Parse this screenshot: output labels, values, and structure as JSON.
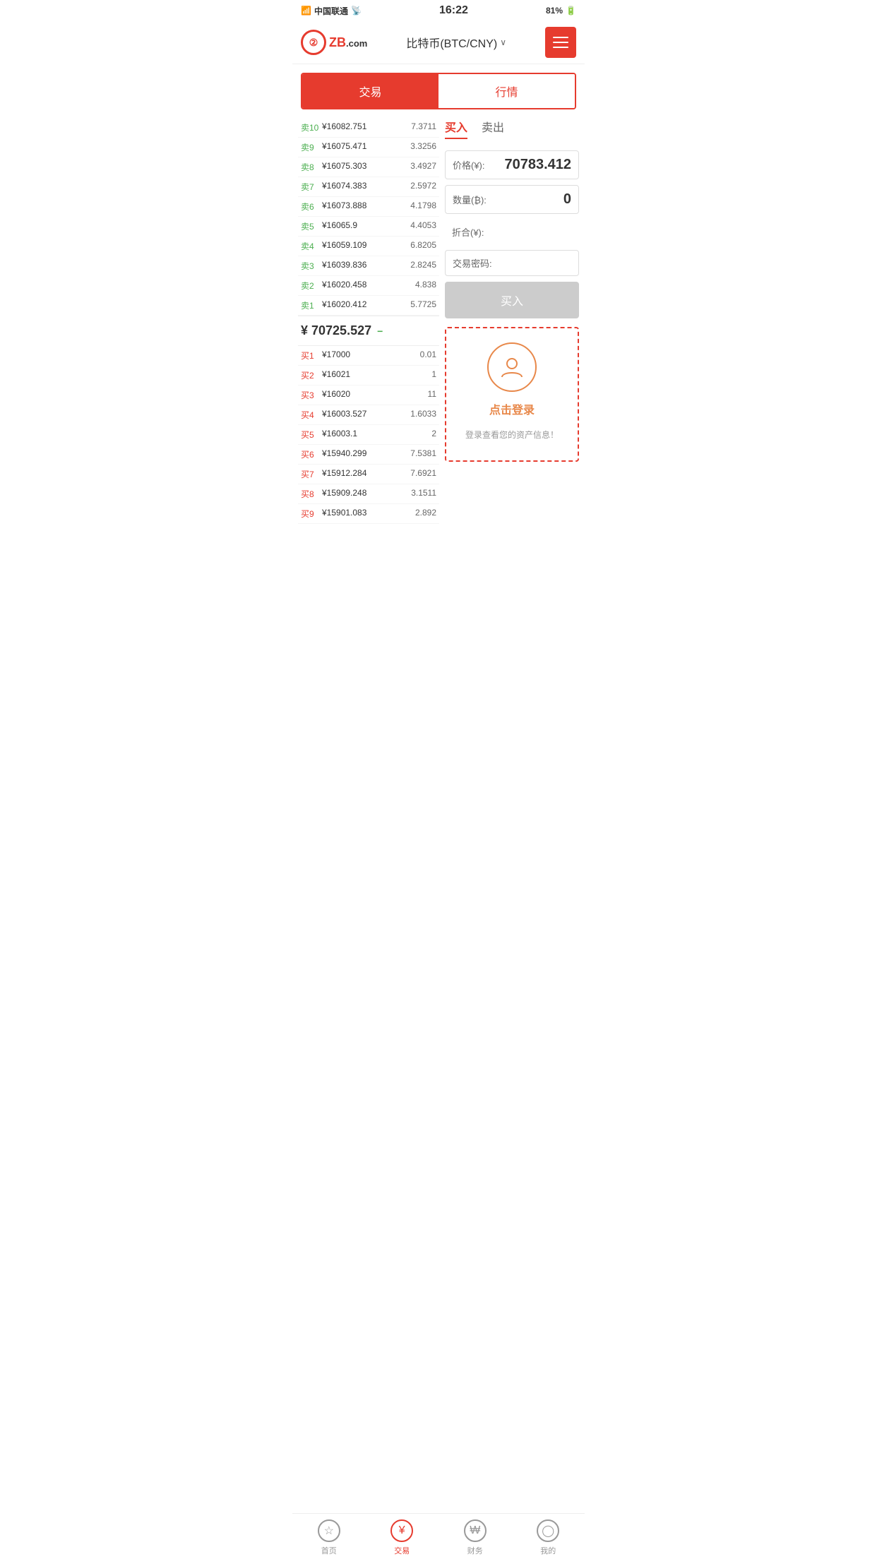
{
  "statusBar": {
    "carrier": "中国联通",
    "time": "16:22",
    "battery": "81%"
  },
  "header": {
    "logoText": "ZB",
    "logoDomain": ".com",
    "title": "比特币(BTC/CNY)",
    "menuIcon": "menu-icon"
  },
  "mainTabs": [
    {
      "id": "trade",
      "label": "交易",
      "active": true
    },
    {
      "id": "market",
      "label": "行情",
      "active": false
    }
  ],
  "orderBook": {
    "sellOrders": [
      {
        "label": "卖10",
        "price": "¥16082.751",
        "amount": "7.3711"
      },
      {
        "label": "卖9",
        "price": "¥16075.471",
        "amount": "3.3256"
      },
      {
        "label": "卖8",
        "price": "¥16075.303",
        "amount": "3.4927"
      },
      {
        "label": "卖7",
        "price": "¥16074.383",
        "amount": "2.5972"
      },
      {
        "label": "卖6",
        "price": "¥16073.888",
        "amount": "4.1798"
      },
      {
        "label": "卖5",
        "price": "¥16065.9",
        "amount": "4.4053"
      },
      {
        "label": "卖4",
        "price": "¥16059.109",
        "amount": "6.8205"
      },
      {
        "label": "卖3",
        "price": "¥16039.836",
        "amount": "2.8245"
      },
      {
        "label": "卖2",
        "price": "¥16020.458",
        "amount": "4.838"
      },
      {
        "label": "卖1",
        "price": "¥16020.412",
        "amount": "5.7725"
      }
    ],
    "currentPrice": "¥ 70725.527",
    "priceChange": "−",
    "buyOrders": [
      {
        "label": "买1",
        "price": "¥17000",
        "amount": "0.01"
      },
      {
        "label": "买2",
        "price": "¥16021",
        "amount": "1"
      },
      {
        "label": "买3",
        "price": "¥16020",
        "amount": "11"
      },
      {
        "label": "买4",
        "price": "¥16003.527",
        "amount": "1.6033"
      },
      {
        "label": "买5",
        "price": "¥16003.1",
        "amount": "2"
      },
      {
        "label": "买6",
        "price": "¥15940.299",
        "amount": "7.5381"
      },
      {
        "label": "买7",
        "price": "¥15912.284",
        "amount": "7.6921"
      },
      {
        "label": "买8",
        "price": "¥15909.248",
        "amount": "3.1511"
      },
      {
        "label": "买9",
        "price": "¥15901.083",
        "amount": "2.892"
      }
    ]
  },
  "tradePanel": {
    "buyTab": "买入",
    "sellTab": "卖出",
    "priceLabel": "价格(¥):",
    "priceValue": "70783.412",
    "quantityLabel": "数量(₿):",
    "quantityValue": "0",
    "totalLabel": "折合(¥):",
    "totalValue": "",
    "passwordLabel": "交易密码:",
    "passwordValue": "",
    "buyButton": "买入",
    "loginPrompt": {
      "loginText": "点击登录",
      "loginDesc": "登录查看您的资产信息！"
    }
  },
  "bottomNav": [
    {
      "id": "home",
      "label": "首页",
      "icon": "⭐",
      "active": false
    },
    {
      "id": "trade",
      "label": "交易",
      "icon": "¥",
      "active": true
    },
    {
      "id": "finance",
      "label": "财务",
      "icon": "$",
      "active": false
    },
    {
      "id": "profile",
      "label": "我的",
      "icon": "👤",
      "active": false
    }
  ]
}
